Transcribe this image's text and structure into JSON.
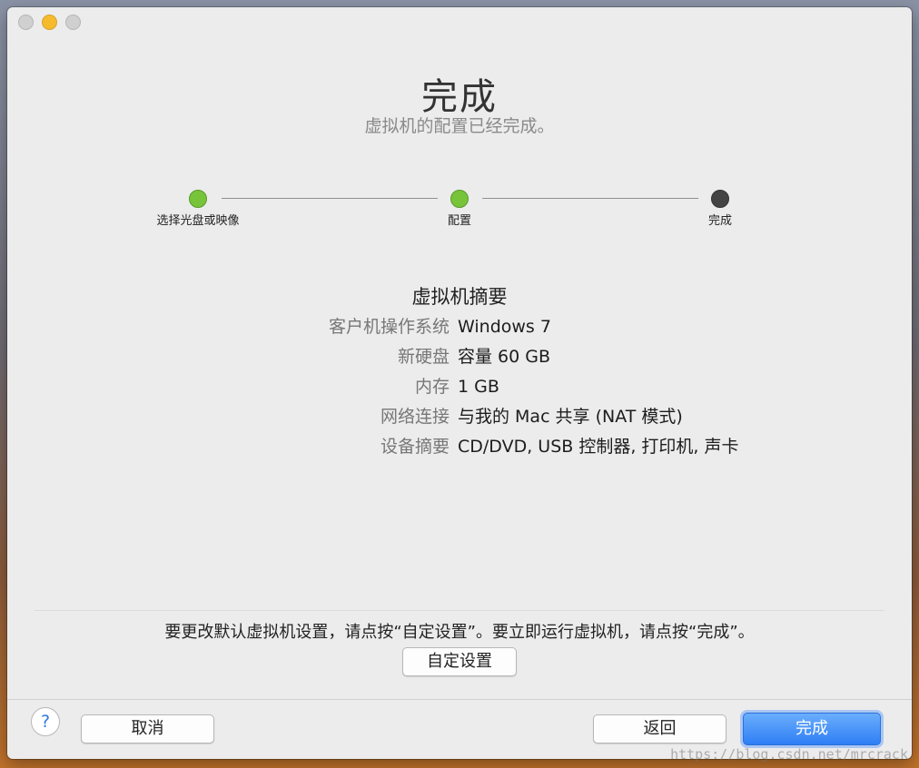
{
  "window": {
    "title": "完成",
    "subtitle": "虚拟机的配置已经完成。"
  },
  "steps": [
    {
      "label": "选择光盘或映像",
      "status": "done"
    },
    {
      "label": "配置",
      "status": "done"
    },
    {
      "label": "完成",
      "status": "current"
    }
  ],
  "summary": {
    "title": "虚拟机摘要",
    "rows": [
      {
        "key": "客户机操作系统",
        "value": "Windows 7"
      },
      {
        "key": "新硬盘",
        "value": "容量 60 GB"
      },
      {
        "key": "内存",
        "value": "1 GB"
      },
      {
        "key": "网络连接",
        "value": "与我的 Mac 共享 (NAT 模式)"
      },
      {
        "key": "设备摘要",
        "value": "CD/DVD, USB 控制器, 打印机, 声卡"
      }
    ]
  },
  "hint": "要更改默认虚拟机设置，请点按“自定设置”。要立即运行虚拟机，请点按“完成”。",
  "buttons": {
    "customize": "自定设置",
    "help": "?",
    "cancel": "取消",
    "back": "返回",
    "finish": "完成"
  },
  "watermark": "https://blog.csdn.net/mrcrack",
  "colors": {
    "step_done": "#77c43a",
    "step_current": "#444444",
    "primary_button": "#2f7ef5",
    "traffic_minimize": "#f6bb2d"
  }
}
